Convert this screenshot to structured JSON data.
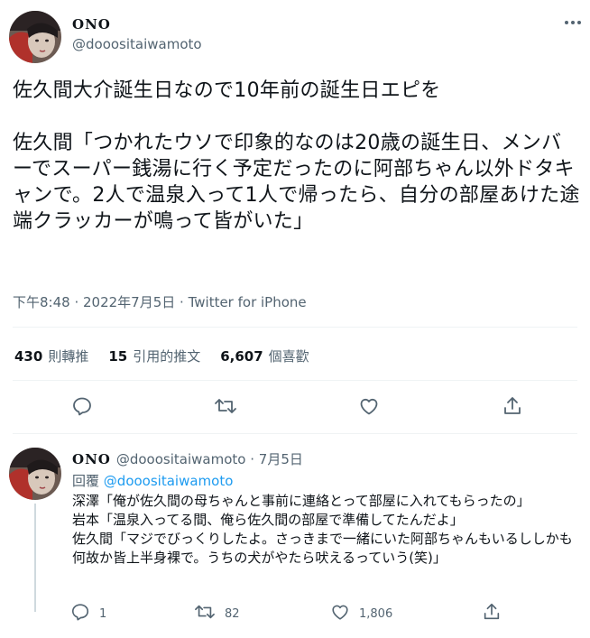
{
  "main_tweet": {
    "display_name": "ONO",
    "handle": "@dooositaiwamoto",
    "text": "佐久間大介誕生日なので10年前の誕生日エピを\n\n佐久間「つかれたウソで印象的なのは20歳の誕生日、メンバーでスーパー銭湯に行く予定だったのに阿部ちゃん以外ドタキャンで。2人で温泉入って1人で帰ったら、自分の部屋あけた途端クラッカーが鳴って皆がいた」",
    "time": "下午8:48",
    "separator": " · ",
    "date": "2022年7月5日",
    "source": "Twitter for iPhone",
    "stats": [
      {
        "count": "430",
        "label": "則轉推"
      },
      {
        "count": "15",
        "label": "引用的推文"
      },
      {
        "count": "6,607",
        "label": "個喜歡"
      }
    ],
    "icons": [
      "more-icon",
      "reply-icon",
      "retweet-icon",
      "like-icon",
      "share-icon"
    ]
  },
  "reply_tweet": {
    "display_name": "ONO",
    "handle": "@dooositaiwamoto",
    "dot": "·",
    "date": "7月5日",
    "reply_prefix": "回覆",
    "reply_to": "@dooositaiwamoto",
    "text": "深澤「俺が佐久間の母ちゃんと事前に連絡とって部屋に入れてもらったの」\n岩本「温泉入ってる間、俺ら佐久間の部屋で準備してたんだよ」\n佐久間「マジでびっくりしたよ。さっきまで一緒にいた阿部ちゃんもいるししかも何故か皆上半身裸で。うちの犬がやたら吠えるっていう(笑)」",
    "reply_count": "1",
    "retweet_count": "82",
    "like_count": "1,806"
  },
  "colors": {
    "text": "#0f1419",
    "secondary": "#536471",
    "link": "#1d9bf0",
    "divider": "#eff3f4"
  }
}
